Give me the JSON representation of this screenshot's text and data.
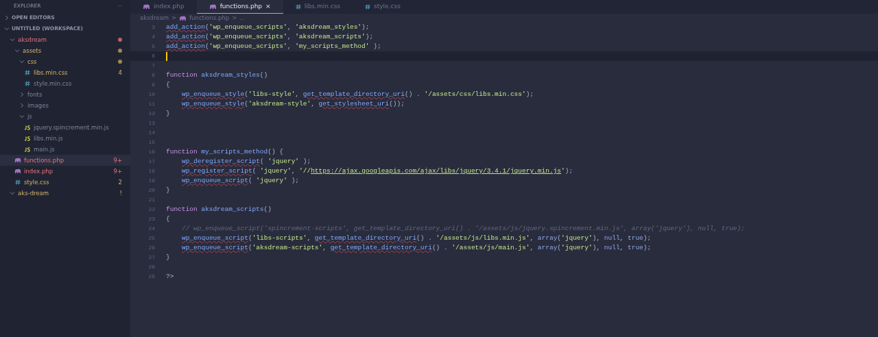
{
  "explorer": {
    "title": "EXPLORER",
    "more": "···",
    "sections": [
      {
        "label": "OPEN EDITORS",
        "expanded": false
      },
      {
        "label": "UNTITLED (WORKSPACE)",
        "expanded": true,
        "tree": [
          {
            "label": "aksdream",
            "kind": "folder",
            "expanded": true,
            "error": true,
            "warning": false,
            "dot": true,
            "selected": false,
            "children": [
              {
                "label": "assets",
                "kind": "folder",
                "expanded": true,
                "error": false,
                "warning": true,
                "dot": true,
                "selected": false,
                "children": [
                  {
                    "label": "css",
                    "kind": "folder",
                    "expanded": true,
                    "error": false,
                    "warning": true,
                    "dot": true,
                    "selected": false,
                    "children": [
                      {
                        "label": "libs.min.css",
                        "kind": "css",
                        "error": false,
                        "warning": true,
                        "badge": "4",
                        "selected": false
                      },
                      {
                        "label": "style.min.css",
                        "kind": "css",
                        "error": false,
                        "warning": false,
                        "selected": false
                      }
                    ]
                  },
                  {
                    "label": "fonts",
                    "kind": "folder",
                    "expanded": false,
                    "error": false,
                    "warning": false,
                    "selected": false
                  },
                  {
                    "label": "images",
                    "kind": "folder",
                    "expanded": false,
                    "error": false,
                    "warning": false,
                    "selected": false
                  },
                  {
                    "label": "js",
                    "kind": "folder",
                    "expanded": true,
                    "error": false,
                    "warning": false,
                    "selected": false,
                    "children": [
                      {
                        "label": "jquery.spincrement.min.js",
                        "kind": "js",
                        "error": false,
                        "warning": false,
                        "selected": false
                      },
                      {
                        "label": "libs.min.js",
                        "kind": "js",
                        "error": false,
                        "warning": false,
                        "selected": false
                      },
                      {
                        "label": "main.js",
                        "kind": "js",
                        "error": false,
                        "warning": false,
                        "selected": false
                      }
                    ]
                  }
                ]
              },
              {
                "label": "functions.php",
                "kind": "php",
                "error": true,
                "warning": false,
                "badge": "9+",
                "selected": true
              },
              {
                "label": "index.php",
                "kind": "php",
                "error": true,
                "warning": false,
                "badge": "9+",
                "selected": false
              },
              {
                "label": "style.css",
                "kind": "css",
                "error": false,
                "warning": true,
                "badge": "2",
                "selected": false
              }
            ]
          },
          {
            "label": "aks-dream",
            "kind": "folder",
            "expanded": true,
            "error": false,
            "warning": true,
            "badge": "!",
            "selected": false
          }
        ]
      }
    ]
  },
  "tabs": [
    {
      "label": "index.php",
      "kind": "php",
      "selected": false
    },
    {
      "label": "functions.php",
      "kind": "php",
      "selected": true,
      "close": "×"
    },
    {
      "label": "libs.min.css",
      "kind": "css",
      "selected": false
    },
    {
      "label": "style.css",
      "kind": "css",
      "selected": false
    }
  ],
  "breadcrumb": [
    {
      "label": "aksdream",
      "separator": ">"
    },
    {
      "label": "functions.php",
      "kind": "php",
      "separator": ">"
    },
    {
      "label": "..."
    }
  ],
  "editor": {
    "lines": [
      {
        "number": "3",
        "current": false,
        "tokens": [
          {
            "kind": "call",
            "text": "add_action"
          },
          {
            "kind": "punc",
            "text": "("
          },
          {
            "kind": "str",
            "text": "'wp_enqueue_scripts'"
          },
          {
            "kind": "punc",
            "text": ", "
          },
          {
            "kind": "str",
            "text": "'aksdream_styles'"
          },
          {
            "kind": "punc",
            "text": ");"
          }
        ]
      },
      {
        "number": "4",
        "current": false,
        "tokens": [
          {
            "kind": "call",
            "text": "add_action"
          },
          {
            "kind": "punc",
            "text": "("
          },
          {
            "kind": "str",
            "text": "'wp_enqueue_scripts'"
          },
          {
            "kind": "punc",
            "text": ", "
          },
          {
            "kind": "str",
            "text": "'aksdream_scripts'"
          },
          {
            "kind": "punc",
            "text": ");"
          }
        ]
      },
      {
        "number": "5",
        "current": false,
        "tokens": [
          {
            "kind": "call",
            "text": "add_action"
          },
          {
            "kind": "punc",
            "text": "("
          },
          {
            "kind": "str",
            "text": "'wp_enqueue_scripts'"
          },
          {
            "kind": "punc",
            "text": ", "
          },
          {
            "kind": "str",
            "text": "'my_scripts_method'"
          },
          {
            "kind": "punc",
            "text": " );"
          }
        ]
      },
      {
        "number": "6",
        "current": true
      },
      {
        "number": "7",
        "current": false
      },
      {
        "number": "8",
        "current": false,
        "tokens": [
          {
            "kind": "kw",
            "text": "function"
          },
          {
            "kind": "fn",
            "text": "aksdream_styles"
          },
          {
            "kind": "punc",
            "text": "()"
          }
        ]
      },
      {
        "number": "9",
        "current": false,
        "tokens": [
          {
            "kind": "punc",
            "text": "{"
          }
        ]
      },
      {
        "number": "10",
        "current": false,
        "indented": true,
        "tokens": [
          {
            "kind": "call",
            "text": "wp_enqueue_style"
          },
          {
            "kind": "punc",
            "text": "("
          },
          {
            "kind": "str",
            "text": "'libs-style'"
          },
          {
            "kind": "punc",
            "text": ", "
          },
          {
            "kind": "call",
            "text": "get_template_directory_uri"
          },
          {
            "kind": "punc",
            "text": "() . "
          },
          {
            "kind": "str",
            "text": "'/assets/css/libs.min.css'"
          },
          {
            "kind": "punc",
            "text": ");"
          }
        ]
      },
      {
        "number": "11",
        "current": false,
        "indented": true,
        "tokens": [
          {
            "kind": "call",
            "text": "wp_enqueue_style"
          },
          {
            "kind": "punc",
            "text": "("
          },
          {
            "kind": "str",
            "text": "'aksdream-style'"
          },
          {
            "kind": "punc",
            "text": ", "
          },
          {
            "kind": "call",
            "text": "get_stylesheet_uri"
          },
          {
            "kind": "punc",
            "text": "());"
          }
        ]
      },
      {
        "number": "12",
        "current": false,
        "tokens": [
          {
            "kind": "punc",
            "text": "}"
          }
        ]
      },
      {
        "number": "13",
        "current": false
      },
      {
        "number": "14",
        "current": false
      },
      {
        "number": "15",
        "current": false
      },
      {
        "number": "16",
        "current": false,
        "tokens": [
          {
            "kind": "kw",
            "text": "function"
          },
          {
            "kind": "fn",
            "text": "my_scripts_method"
          },
          {
            "kind": "punc",
            "text": "() {"
          }
        ]
      },
      {
        "number": "17",
        "current": false,
        "indented": true,
        "tokens": [
          {
            "kind": "call",
            "text": "wp_deregister_script"
          },
          {
            "kind": "punc",
            "text": "( "
          },
          {
            "kind": "str",
            "text": "'jquery'"
          },
          {
            "kind": "punc",
            "text": " );"
          }
        ]
      },
      {
        "number": "18",
        "current": false,
        "indented": true,
        "tokens": [
          {
            "kind": "call",
            "text": "wp_register_script"
          },
          {
            "kind": "punc",
            "text": "( "
          },
          {
            "kind": "str",
            "text": "'jquery'"
          },
          {
            "kind": "punc",
            "text": ", "
          },
          {
            "kind": "str",
            "text": "'//"
          },
          {
            "kind": "url",
            "text": "https://ajax.googleapis.com/ajax/libs/jquery/3.4.1/jquery.min.js"
          },
          {
            "kind": "str",
            "text": "'"
          },
          {
            "kind": "punc",
            "text": ");"
          }
        ]
      },
      {
        "number": "19",
        "current": false,
        "indented": true,
        "tokens": [
          {
            "kind": "call",
            "text": "wp_enqueue_script"
          },
          {
            "kind": "punc",
            "text": "( "
          },
          {
            "kind": "str",
            "text": "'jquery'"
          },
          {
            "kind": "punc",
            "text": " );"
          }
        ]
      },
      {
        "number": "20",
        "current": false,
        "tokens": [
          {
            "kind": "punc",
            "text": "}"
          }
        ]
      },
      {
        "number": "21",
        "current": false
      },
      {
        "number": "22",
        "current": false,
        "tokens": [
          {
            "kind": "kw",
            "text": "function"
          },
          {
            "kind": "fn",
            "text": "aksdream_scripts"
          },
          {
            "kind": "punc",
            "text": "()"
          }
        ]
      },
      {
        "number": "23",
        "current": false,
        "tokens": [
          {
            "kind": "punc",
            "text": "{"
          }
        ]
      },
      {
        "number": "24",
        "current": false,
        "indented": true,
        "tokens": [
          {
            "kind": "comment",
            "text": "// wp_enqueue_script('spincrement-scripts', get_template_directory_uri() . '/assets/js/jquery.spincrement.min.js', array('jquery'), null, true);"
          }
        ]
      },
      {
        "number": "25",
        "current": false,
        "indented": true,
        "tokens": [
          {
            "kind": "call",
            "text": "wp_enqueue_script"
          },
          {
            "kind": "punc",
            "text": "("
          },
          {
            "kind": "str",
            "text": "'libs-scripts'"
          },
          {
            "kind": "punc",
            "text": ", "
          },
          {
            "kind": "call",
            "text": "get_template_directory_uri"
          },
          {
            "kind": "punc",
            "text": "() . "
          },
          {
            "kind": "str",
            "text": "'/assets/js/libs.min.js'"
          },
          {
            "kind": "punc",
            "text": ", "
          },
          {
            "kind": "const",
            "text": "array"
          },
          {
            "kind": "punc",
            "text": "("
          },
          {
            "kind": "str",
            "text": "'jquery'"
          },
          {
            "kind": "punc",
            "text": "), "
          },
          {
            "kind": "const",
            "text": "null"
          },
          {
            "kind": "punc",
            "text": ", "
          },
          {
            "kind": "const",
            "text": "true"
          },
          {
            "kind": "punc",
            "text": ");"
          }
        ]
      },
      {
        "number": "26",
        "current": false,
        "indented": true,
        "tokens": [
          {
            "kind": "call",
            "text": "wp_enqueue_script"
          },
          {
            "kind": "punc",
            "text": "("
          },
          {
            "kind": "str",
            "text": "'aksdream-scripts'"
          },
          {
            "kind": "punc",
            "text": ", "
          },
          {
            "kind": "call",
            "text": "get_template_directory_uri"
          },
          {
            "kind": "punc",
            "text": "() . "
          },
          {
            "kind": "str",
            "text": "'/assets/js/main.js'"
          },
          {
            "kind": "punc",
            "text": ", "
          },
          {
            "kind": "const",
            "text": "array"
          },
          {
            "kind": "punc",
            "text": "("
          },
          {
            "kind": "str",
            "text": "'jquery'"
          },
          {
            "kind": "punc",
            "text": "), "
          },
          {
            "kind": "const",
            "text": "null"
          },
          {
            "kind": "punc",
            "text": ", "
          },
          {
            "kind": "const",
            "text": "true"
          },
          {
            "kind": "punc",
            "text": ");"
          }
        ]
      },
      {
        "number": "27",
        "current": false,
        "tokens": [
          {
            "kind": "punc",
            "text": "}"
          }
        ]
      },
      {
        "number": "28",
        "current": false
      },
      {
        "number": "29",
        "current": false,
        "tokens": [
          {
            "kind": "punc",
            "text": "?>"
          }
        ]
      }
    ]
  }
}
